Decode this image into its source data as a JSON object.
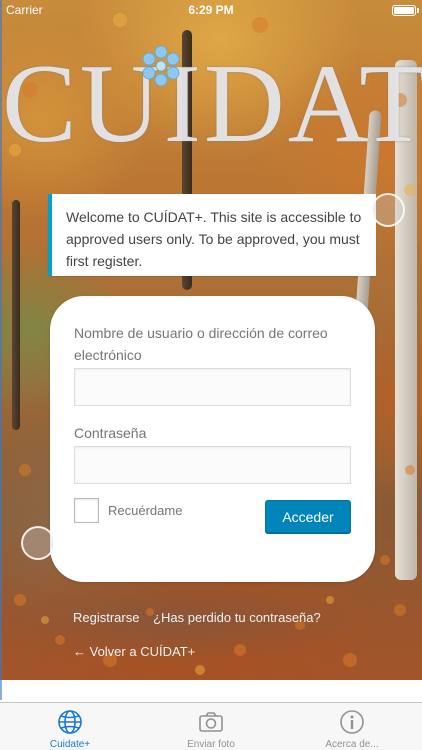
{
  "status_bar": {
    "carrier": "Carrier",
    "time": "6:29 PM"
  },
  "logo": {
    "text": "CUIDAT+",
    "icon": "flower-logo-icon"
  },
  "notice": {
    "text": "Welcome to CUÍDAT+. This site is accessible to approved users only. To be approved, you must first register."
  },
  "login_form": {
    "username_label": "Nombre de usuario o dirección de correo electrónico",
    "username_value": "",
    "password_label": "Contraseña",
    "password_value": "",
    "remember_label": "Recuérdame",
    "remember_checked": false,
    "submit_label": "Acceder"
  },
  "links": {
    "register": "Registrarse",
    "lost_password": "¿Has perdido tu contraseña?",
    "back": "← Volver a CUÍDAT+"
  },
  "tab_bar": {
    "tabs": [
      {
        "label": "Cuidate+",
        "icon": "globe-icon",
        "active": true
      },
      {
        "label": "Enviar foto",
        "icon": "camera-icon",
        "active": false
      },
      {
        "label": "Acerca de...",
        "icon": "info-icon",
        "active": false
      }
    ]
  },
  "colors": {
    "accent": "#00a0d2",
    "button": "#0085ba",
    "tab_active": "#1a78d6",
    "tab_inactive": "#929292"
  }
}
